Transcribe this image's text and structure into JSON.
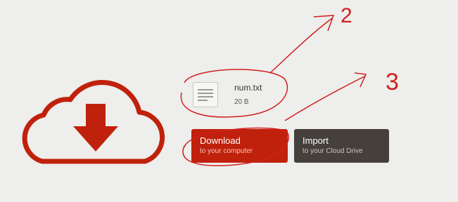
{
  "colors": {
    "background": "#eeeeec",
    "accent_red": "#c0210c",
    "dark_button": "#45403b",
    "annotation_red": "#d21f1f"
  },
  "graphic": {
    "icon": "cloud-download-icon"
  },
  "file": {
    "icon": "text-file-icon",
    "name": "num.txt",
    "size": "20 B"
  },
  "buttons": {
    "download": {
      "title": "Download",
      "subtitle": "to your computer"
    },
    "import": {
      "title": "Import",
      "subtitle": "to your Cloud Drive"
    }
  },
  "annotations": {
    "label_2": "2",
    "label_3": "3"
  }
}
